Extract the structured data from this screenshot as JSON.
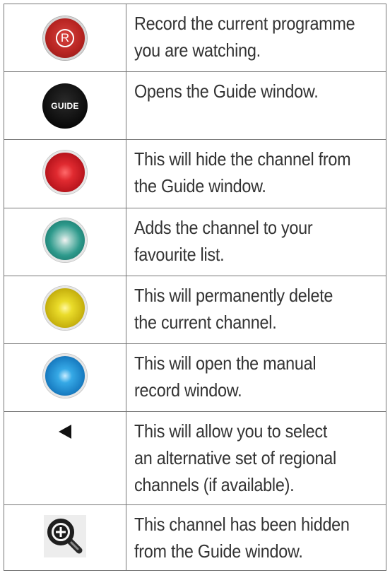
{
  "rows": [
    {
      "icon": "record-button-icon",
      "description": "Record the current programme you are watching.",
      "lines": [
        "Record the current programme",
        "you are watching."
      ],
      "glyph": "R"
    },
    {
      "icon": "guide-button-icon",
      "description": "Opens the Guide window.",
      "lines": [
        "Opens the Guide window."
      ],
      "glyph": "GUIDE"
    },
    {
      "icon": "red-button-icon",
      "description": "This will hide the channel from the Guide window.",
      "lines": [
        "This will hide the channel from",
        "the Guide window."
      ]
    },
    {
      "icon": "green-button-icon",
      "description": "Adds the channel to your favourite list.",
      "lines": [
        "Adds the channel to your",
        "favourite list."
      ]
    },
    {
      "icon": "yellow-button-icon",
      "description": "This will permanently delete the current channel.",
      "lines": [
        "This will permanently delete",
        "the current channel."
      ]
    },
    {
      "icon": "blue-button-icon",
      "description": "This will open the manual record window.",
      "lines": [
        "This will open the manual",
        "record window."
      ]
    },
    {
      "icon": "left-arrow-icon",
      "description": "This will allow you to select an alternative set of regional channels (if available).",
      "lines": [
        "This will allow you to select",
        "an alternative set of regional",
        "channels (if available)."
      ]
    },
    {
      "icon": "hidden-channel-magnifier-icon",
      "description": "This channel has been hidden from the Guide window.",
      "lines": [
        "This channel has been hidden",
        "from the Guide window."
      ]
    }
  ],
  "colors": {
    "record": "#b82522",
    "guide": "#000000",
    "red": "#e02a30",
    "green": "#2e9a8c",
    "yellow": "#eadc2a",
    "blue": "#1a7fc4",
    "border": "#777777",
    "text": "#333333"
  }
}
